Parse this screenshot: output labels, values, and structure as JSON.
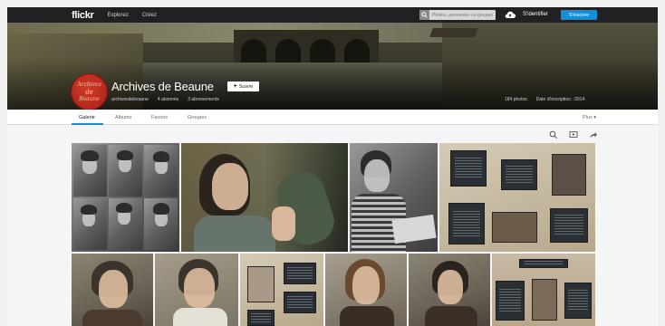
{
  "topnav": {
    "logo": "flickr",
    "links": [
      "Explorez",
      "Créez"
    ],
    "search_placeholder": "Photos, personnes ou groupes",
    "signin": "S'identifier",
    "signup": "S'inscrire"
  },
  "profile": {
    "avatar_text": [
      "Archives",
      "de",
      "Beaune"
    ],
    "title": "Archives de Beaune",
    "follow_label": "Suivre",
    "username": "archivesdebeaune",
    "followers": "4 abonnés",
    "following": "3 abonnements",
    "photos": "184 photos",
    "joined": "Date d'inscription : 2014"
  },
  "tabs": {
    "items": [
      "Galerie",
      "Albums",
      "Favoris",
      "Groupes"
    ],
    "active": "Galerie",
    "more": "Plus ▾"
  },
  "tools": [
    "search-icon",
    "slideshow-icon",
    "share-icon"
  ],
  "colors": {
    "topnav_bg": "#212124",
    "accent_blue": "#128fdc",
    "page_bg": "#f3f5f6"
  }
}
